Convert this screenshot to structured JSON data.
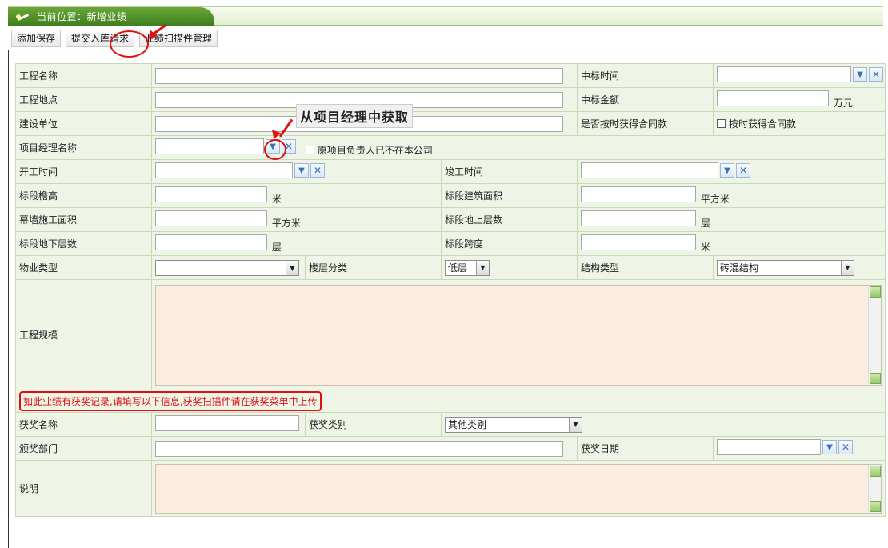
{
  "header": {
    "location_label": "当前位置：新增业绩"
  },
  "toolbar": {
    "add_save": "添加保存",
    "submit_request": "提交入库请求",
    "scan_manage": "业绩扫描件管理"
  },
  "annotation": {
    "hint_text": "从项目经理中获取"
  },
  "form": {
    "project_name": "工程名称",
    "bid_time": "中标时间",
    "project_location": "工程地点",
    "bid_amount": "中标金额",
    "unit_wan": "万元",
    "construction_unit": "建设单位",
    "contract_on_time_label": "是否按时获得合同款",
    "contract_on_time_chk": "按时获得合同款",
    "pm_name": "项目经理名称",
    "pm_left_chk": "原项目负责人已不在本公司",
    "start_time": "开工时间",
    "end_time": "竣工时间",
    "eave_height": "标段檐高",
    "unit_m": "米",
    "build_area": "标段建筑面积",
    "unit_sqm": "平方米",
    "curtain_area": "幕墙施工面积",
    "above_floors": "标段地上层数",
    "unit_floor": "层",
    "below_floors": "标段地下层数",
    "span": "标段跨度",
    "property_type": "物业类型",
    "floor_class": "楼层分类",
    "floor_class_value": "低层",
    "structure_type": "结构类型",
    "structure_type_value": "砖混结构",
    "scale": "工程规模",
    "notice": "如此业绩有获奖记录,请填写以下信息,获奖扫描件请在获奖菜单中上传",
    "award_name": "获奖名称",
    "award_category": "获奖类别",
    "award_category_value": "其他类别",
    "award_dept": "颁奖部门",
    "award_date": "获奖日期",
    "description": "说明"
  }
}
